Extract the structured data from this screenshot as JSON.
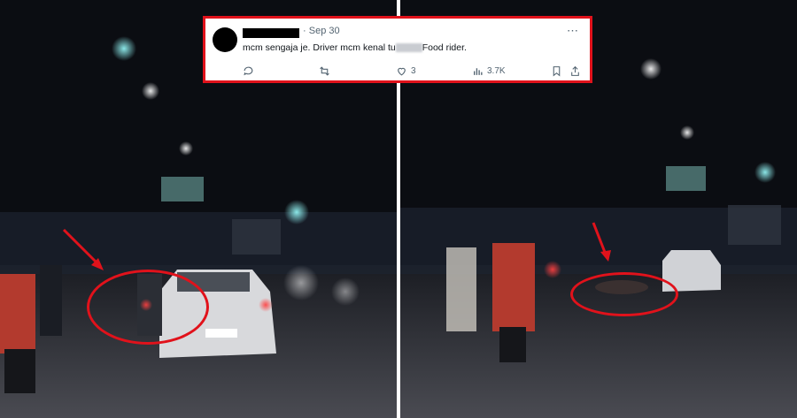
{
  "tweet": {
    "date": "Sep 30",
    "more_icon": "⋯",
    "text_before": "mcm sengaja je. Driver mcm kenal tu",
    "text_after": "Food rider.",
    "actions": {
      "reply_count": "",
      "repost_count": "",
      "like_count": "3",
      "views_count": "3.7K"
    }
  },
  "colors": {
    "annotation": "#e1121b",
    "meta_text": "#536471",
    "night_sky": "#0b0d12"
  },
  "icons": [
    "reply-icon",
    "repost-icon",
    "like-icon",
    "views-icon",
    "bookmark-icon",
    "share-icon",
    "red-arrow-icon"
  ]
}
